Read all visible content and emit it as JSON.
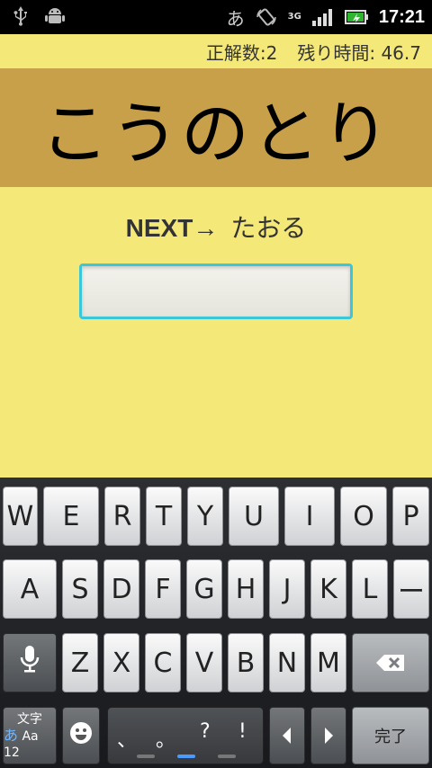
{
  "status_bar": {
    "ime": "あ",
    "network": "3G",
    "time": "17:21",
    "icons": [
      "usb-icon",
      "android-debug-icon",
      "rotation-icon",
      "signal-icon",
      "battery-icon"
    ]
  },
  "info": {
    "score": "正解数:2",
    "time_left": "残り時間: 46.7"
  },
  "word": "こうのとり",
  "next": {
    "label": "NEXT→",
    "word": "たおる"
  },
  "input": {
    "value": "",
    "placeholder": ""
  },
  "keyboard": {
    "row1": [
      "W",
      "E",
      "R",
      "T",
      "Y",
      "U",
      "I",
      "O",
      "P"
    ],
    "row2": [
      "A",
      "S",
      "D",
      "F",
      "G",
      "H",
      "J",
      "K",
      "L",
      "ー"
    ],
    "row3": [
      "Z",
      "X",
      "C",
      "V",
      "B",
      "N",
      "M"
    ],
    "mode_key": {
      "line1": "文字",
      "kana": "あ",
      "latin": "Aa",
      "num": "12"
    },
    "punctuation": [
      "、",
      "。",
      "?",
      "!"
    ],
    "done_label": "完了",
    "colors": {
      "active_indicator": "#4a9bff",
      "input_border": "#3cc6d8",
      "band": "#c8a04a",
      "background": "#f4e878"
    }
  }
}
